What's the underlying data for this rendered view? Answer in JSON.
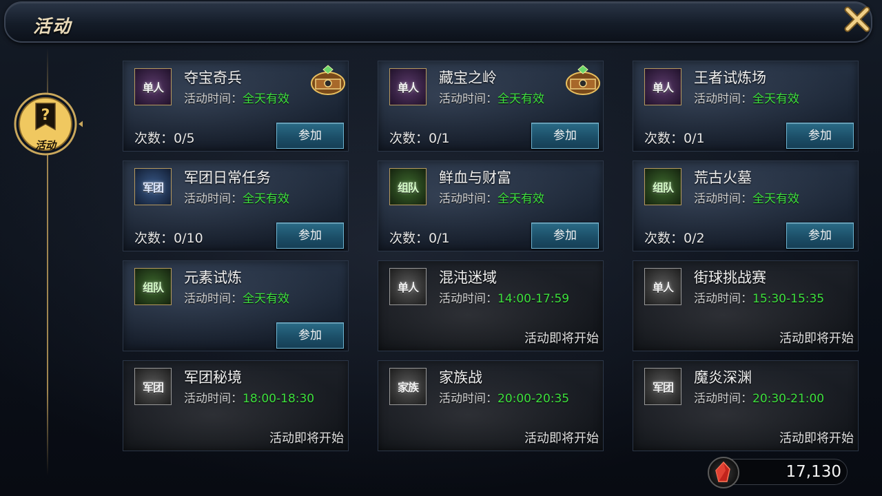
{
  "window": {
    "title": "活动"
  },
  "sidebar": {
    "tab_label": "活动",
    "tab_icon": "question-banner-icon"
  },
  "currency": {
    "value": "17,130",
    "icon": "red-crystal-icon"
  },
  "colors": {
    "time_value": "#3ee03e",
    "join_button": "#1b4d66"
  },
  "activities": [
    {
      "name": "夺宝奇兵",
      "badge": "单人",
      "badge_type": "solo",
      "time_label": "活动时间：",
      "time_value": "全天有效",
      "count": "次数：0/5",
      "action": "参加",
      "reward": true
    },
    {
      "name": "藏宝之岭",
      "badge": "单人",
      "badge_type": "solo",
      "time_label": "活动时间：",
      "time_value": "全天有效",
      "count": "次数：0/1",
      "action": "参加",
      "reward": true
    },
    {
      "name": "王者试炼场",
      "badge": "单人",
      "badge_type": "solo",
      "time_label": "活动时间：",
      "time_value": "全天有效",
      "count": "次数：0/1",
      "action": "参加",
      "reward": false
    },
    {
      "name": "军团日常任务",
      "badge": "军团",
      "badge_type": "legion",
      "time_label": "活动时间：",
      "time_value": "全天有效",
      "count": "次数：0/10",
      "action": "参加",
      "reward": false
    },
    {
      "name": "鲜血与财富",
      "badge": "组队",
      "badge_type": "team",
      "time_label": "活动时间：",
      "time_value": "全天有效",
      "count": "次数：0/1",
      "action": "参加",
      "reward": false
    },
    {
      "name": "荒古火墓",
      "badge": "组队",
      "badge_type": "team",
      "time_label": "活动时间：",
      "time_value": "全天有效",
      "count": "次数：0/2",
      "action": "参加",
      "reward": false
    },
    {
      "name": "元素试炼",
      "badge": "组队",
      "badge_type": "team",
      "time_label": "活动时间：",
      "time_value": "全天有效",
      "count": "",
      "action": "参加",
      "reward": false
    },
    {
      "name": "混沌迷域",
      "badge": "单人",
      "badge_type": "gray",
      "time_label": "活动时间：",
      "time_value": "14:00-17:59",
      "status": "活动即将开始"
    },
    {
      "name": "街球挑战赛",
      "badge": "单人",
      "badge_type": "gray",
      "time_label": "活动时间：",
      "time_value": "15:30-15:35",
      "status": "活动即将开始"
    },
    {
      "name": "军团秘境",
      "badge": "军团",
      "badge_type": "gray",
      "time_label": "活动时间：",
      "time_value": "18:00-18:30",
      "status": "活动即将开始"
    },
    {
      "name": "家族战",
      "badge": "家族",
      "badge_type": "gray",
      "time_label": "活动时间：",
      "time_value": "20:00-20:35",
      "status": "活动即将开始"
    },
    {
      "name": "魔炎深渊",
      "badge": "军团",
      "badge_type": "gray",
      "time_label": "活动时间：",
      "time_value": "20:30-21:00",
      "status": "活动即将开始"
    }
  ]
}
